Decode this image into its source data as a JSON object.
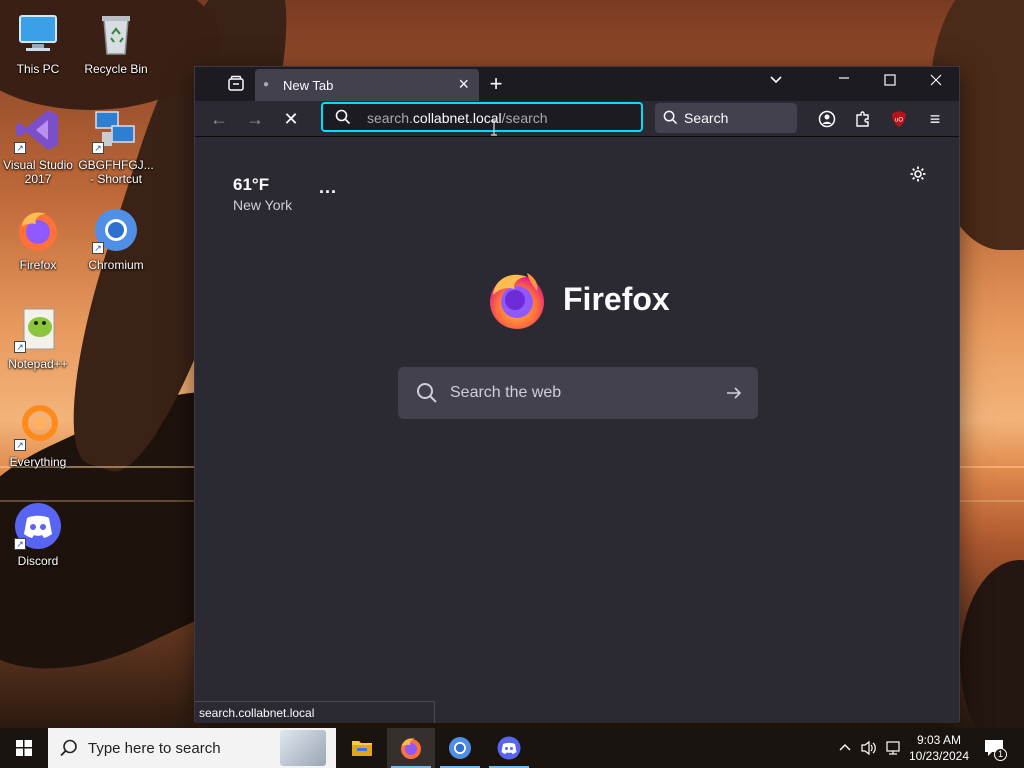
{
  "desktop": {
    "icons": [
      {
        "label": "This PC"
      },
      {
        "label": "Recycle Bin"
      },
      {
        "label": "Visual Studio 2017"
      },
      {
        "label": "GBGFHFGJ... - Shortcut"
      },
      {
        "label": "Firefox"
      },
      {
        "label": "Chromium"
      },
      {
        "label": "Notepad++"
      },
      {
        "label": "Everything"
      },
      {
        "label": "Discord"
      }
    ]
  },
  "browser": {
    "tab": {
      "title": "New Tab"
    },
    "url": {
      "prefix": "search.",
      "host": "collabnet.local",
      "path": "/search"
    },
    "searchbar": {
      "placeholder": "Search"
    },
    "weather": {
      "temp": "61°F",
      "city": "New York",
      "more": "..."
    },
    "brand": {
      "wordmark": "Firefox"
    },
    "search_box": {
      "placeholder": "Search the web"
    },
    "status_tip": "search.collabnet.local"
  },
  "taskbar": {
    "search_placeholder": "Type here to search",
    "clock": {
      "time": "9:03 AM",
      "date": "10/23/2024"
    },
    "notification_count": "1"
  },
  "colors": {
    "accent_focus": "#00ddff",
    "browser_bg": "#2b2a33",
    "toolbar_bg": "#1c1b22",
    "tab_active": "#42414d"
  }
}
